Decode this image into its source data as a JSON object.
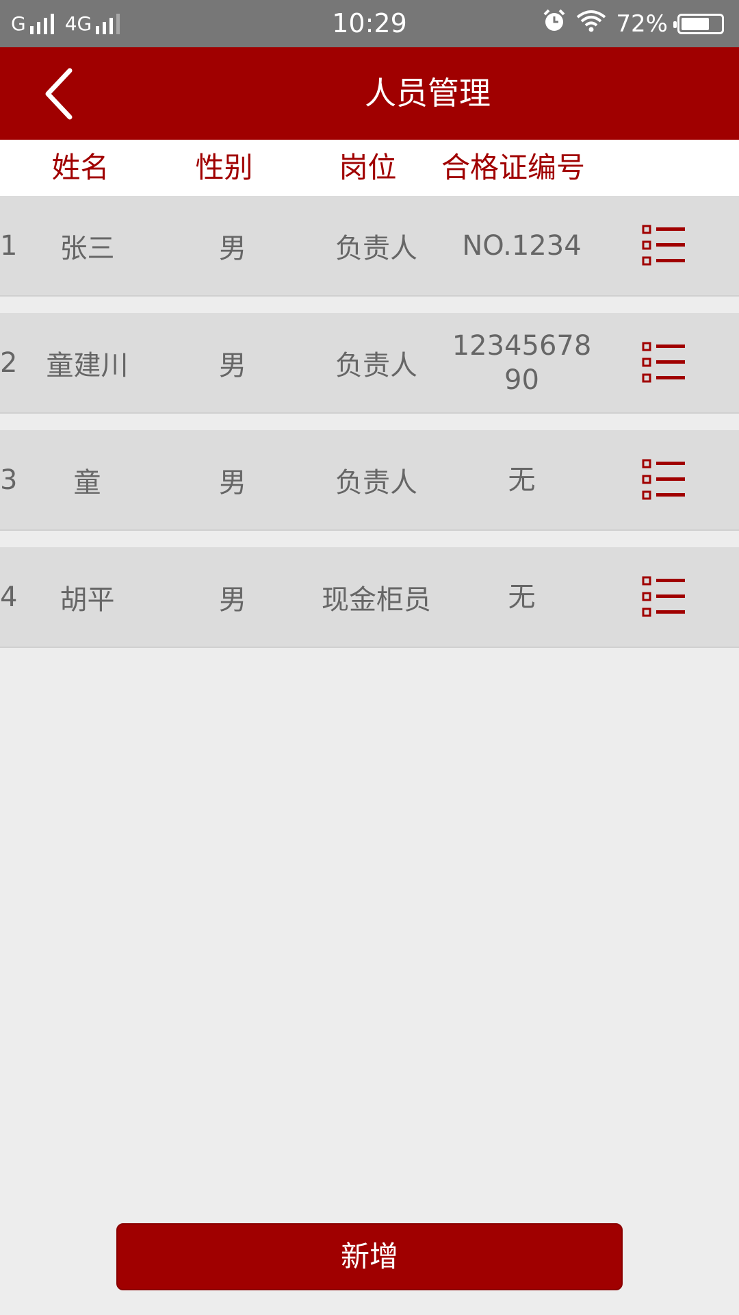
{
  "status_bar": {
    "carrier1": "G",
    "carrier2": "4G",
    "time": "10:29",
    "battery": "72%",
    "battery_level": 0.72
  },
  "header": {
    "title": "人员管理",
    "back_icon": "chevron-left-icon"
  },
  "columns": [
    "姓名",
    "性别",
    "岗位",
    "合格证编号"
  ],
  "rows": [
    {
      "index": "1",
      "name": "张三",
      "gender": "男",
      "post": "负责人",
      "cert": "NO.1234"
    },
    {
      "index": "2",
      "name": "童建川",
      "gender": "男",
      "post": "负责人",
      "cert": "1234567890"
    },
    {
      "index": "3",
      "name": "童",
      "gender": "男",
      "post": "负责人",
      "cert": "无"
    },
    {
      "index": "4",
      "name": "胡平",
      "gender": "男",
      "post": "现金柜员",
      "cert": "无"
    }
  ],
  "add_button": {
    "label": "新增"
  },
  "colors": {
    "accent": "#a00000",
    "row_bg": "#dcdcdc",
    "page_bg": "#ededed"
  }
}
